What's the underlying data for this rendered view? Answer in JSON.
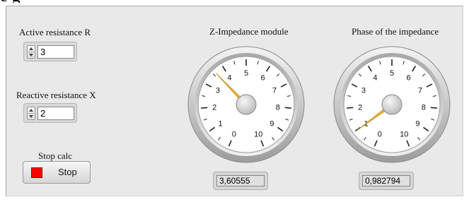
{
  "header_partial_text": "e g",
  "controls": {
    "active_resistance": {
      "label": "Active resistance R",
      "value": "3"
    },
    "reactive_resistance": {
      "label": "Reactive resistance X",
      "value": "2"
    },
    "stop": {
      "label": "Stop calc",
      "button_label": "Stop"
    }
  },
  "gauges": [
    {
      "title": "Z-Impedance module",
      "value": 3.60555,
      "display": "3,60555",
      "scale_labels": [
        "0",
        "1",
        "2",
        "3",
        "4",
        "5",
        "6",
        "7",
        "8",
        "9",
        "10"
      ],
      "scale_min": 0,
      "scale_max": 10
    },
    {
      "title": "Phase of the impedance",
      "value": 0.982794,
      "display": "0,982794",
      "scale_labels": [
        "0",
        "1",
        "2",
        "3",
        "4",
        "5",
        "6",
        "7",
        "8",
        "9",
        "10"
      ],
      "scale_min": 0,
      "scale_max": 10
    }
  ],
  "colors": {
    "panel_bg": "#e9e9e9",
    "needle": "#e6b23a",
    "stop_led": "#ff0000"
  }
}
